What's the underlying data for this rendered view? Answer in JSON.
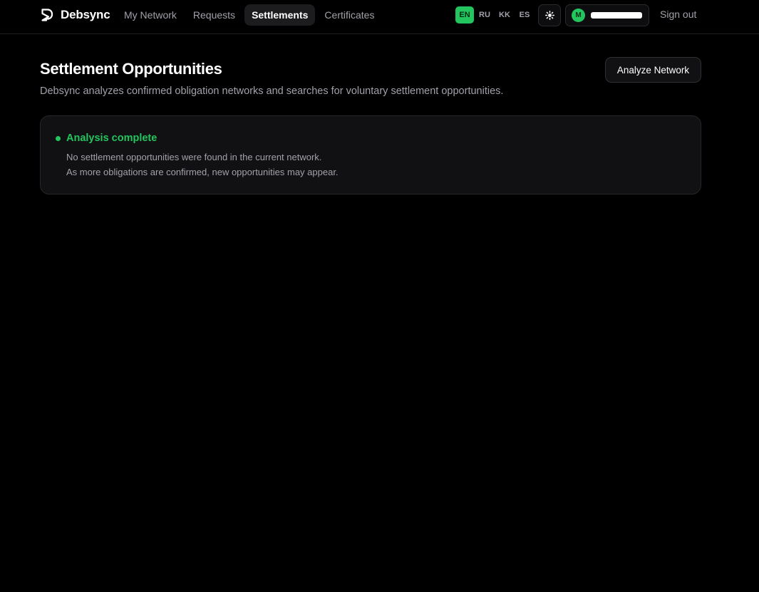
{
  "app": {
    "brand_name": "Debsync",
    "accent_color": "#22c55e"
  },
  "nav": {
    "items": [
      {
        "label": "My Network",
        "active": false
      },
      {
        "label": "Requests",
        "active": false
      },
      {
        "label": "Settlements",
        "active": true
      },
      {
        "label": "Certificates",
        "active": false
      }
    ]
  },
  "languages": {
    "items": [
      {
        "code": "EN",
        "active": true
      },
      {
        "code": "RU",
        "active": false
      },
      {
        "code": "KK",
        "active": false
      },
      {
        "code": "ES",
        "active": false
      }
    ]
  },
  "theme_toggle": {
    "icon": "sun-icon"
  },
  "user": {
    "avatar_initial": "M",
    "name_redacted": true
  },
  "auth": {
    "sign_out_label": "Sign out"
  },
  "page": {
    "title": "Settlement Opportunities",
    "subtitle": "Debsync analyzes confirmed obligation networks and searches for voluntary settlement opportunities.",
    "analyze_button_label": "Analyze Network"
  },
  "status": {
    "title": "Analysis complete",
    "lines": [
      "No settlement opportunities were found in the current network.",
      "As more obligations are confirmed, new opportunities may appear."
    ],
    "color": "#22c55e"
  }
}
